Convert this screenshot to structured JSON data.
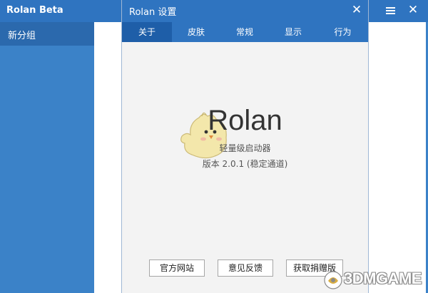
{
  "main_window": {
    "title": "Rolan Beta",
    "menu_icon": "hamburger-icon",
    "close_icon": "close-icon",
    "sidebar": {
      "items": [
        {
          "label": "新分组",
          "active": true
        }
      ]
    }
  },
  "settings_dialog": {
    "title": "Rolan 设置",
    "close_icon": "close-icon",
    "tabs": [
      {
        "label": "关于",
        "active": true
      },
      {
        "label": "皮肤",
        "active": false
      },
      {
        "label": "常规",
        "active": false
      },
      {
        "label": "显示",
        "active": false
      },
      {
        "label": "行为",
        "active": false
      }
    ],
    "about": {
      "app_name": "Rolan",
      "tagline": "轻量级启动器",
      "version": "版本 2.0.1 (稳定通道)",
      "mascot_icon": "chick-mascot-icon",
      "buttons": [
        {
          "label": "官方网站"
        },
        {
          "label": "意见反馈"
        },
        {
          "label": "获取捐赠版"
        }
      ]
    }
  },
  "watermark": {
    "text": "3DMGAME",
    "icon": "3dm-logo-icon"
  },
  "colors": {
    "title_bar": "#2f74c0",
    "active_tab": "#1e5ea8",
    "sidebar": "#3b82c8",
    "sidebar_active": "#2b69ad",
    "dialog_bg": "#f3f3f3"
  }
}
